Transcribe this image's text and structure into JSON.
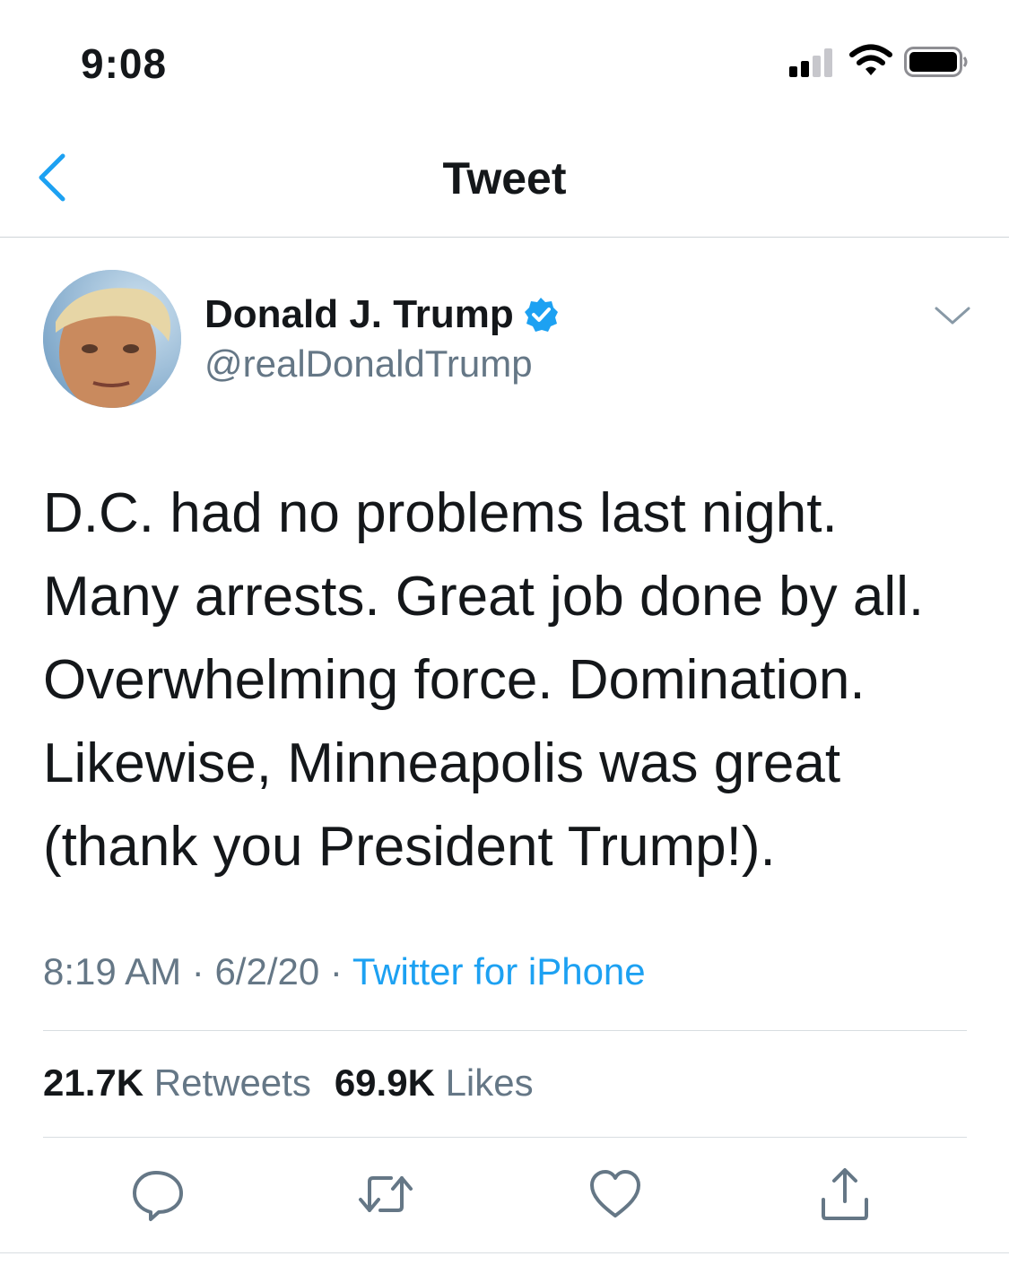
{
  "status_bar": {
    "time": "9:08"
  },
  "nav": {
    "title": "Tweet"
  },
  "author": {
    "name": "Donald J. Trump",
    "handle": "@realDonaldTrump",
    "verified": true
  },
  "tweet": {
    "text": "D.C. had no problems last night.\nMany arrests. Great job done by all.\nOverwhelming force. Domination.\nLikewise, Minneapolis was great\n(thank you President Trump!)."
  },
  "meta": {
    "time": "8:19 AM",
    "date": "6/2/20",
    "separator": "·",
    "source": "Twitter for iPhone"
  },
  "stats": {
    "retweets_count": "21.7K",
    "retweets_label": "Retweets",
    "likes_count": "69.9K",
    "likes_label": "Likes"
  },
  "actions": [
    "reply-icon",
    "retweet-icon",
    "like-icon",
    "share-icon"
  ],
  "colors": {
    "accent": "#1da1f2",
    "secondary_text": "#657786",
    "primary_text": "#14171a"
  }
}
